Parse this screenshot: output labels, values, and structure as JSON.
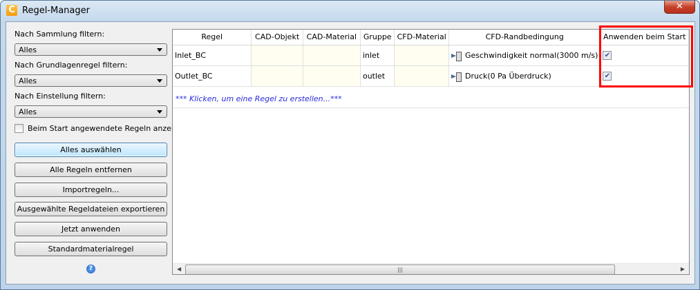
{
  "window": {
    "title": "Regel-Manager",
    "close_label": "✕"
  },
  "sidebar": {
    "filters": [
      {
        "label": "Nach Sammlung filtern:",
        "value": "Alles"
      },
      {
        "label": "Nach Grundlagenregel filtern:",
        "value": "Alles"
      },
      {
        "label": "Nach Einstellung filtern:",
        "value": "Alles"
      }
    ],
    "show_startup_label": "Beim Start angewendete Regeln anzeigen",
    "buttons": [
      "Alles auswählen",
      "Alle Regeln entfernen",
      "Importregeln...",
      "Ausgewählte Regeldateien exportieren",
      "Jetzt anwenden",
      "Standardmaterialregel"
    ],
    "help": "?"
  },
  "table": {
    "columns": [
      "Regel",
      "CAD-Objekt",
      "CAD-Material",
      "Gruppe",
      "CFD-Material",
      "CFD-Randbedingung",
      "Anwenden beim Start"
    ],
    "rows": [
      {
        "regel": "Inlet_BC",
        "cad_objekt": "",
        "cad_material": "",
        "gruppe": "inlet",
        "cfd_material": "",
        "randbedingung": "Geschwindigkeit normal(3000 m/s)",
        "anwenden": true
      },
      {
        "regel": "Outlet_BC",
        "cad_objekt": "",
        "cad_material": "",
        "gruppe": "outlet",
        "cfd_material": "",
        "randbedingung": "Druck(0 Pa Überdruck)",
        "anwenden": true
      }
    ],
    "add_row": "*** Klicken, um eine Regel zu erstellen...***"
  },
  "colors": {
    "highlight": "#ff0000",
    "add_link": "#2a2ae0"
  }
}
